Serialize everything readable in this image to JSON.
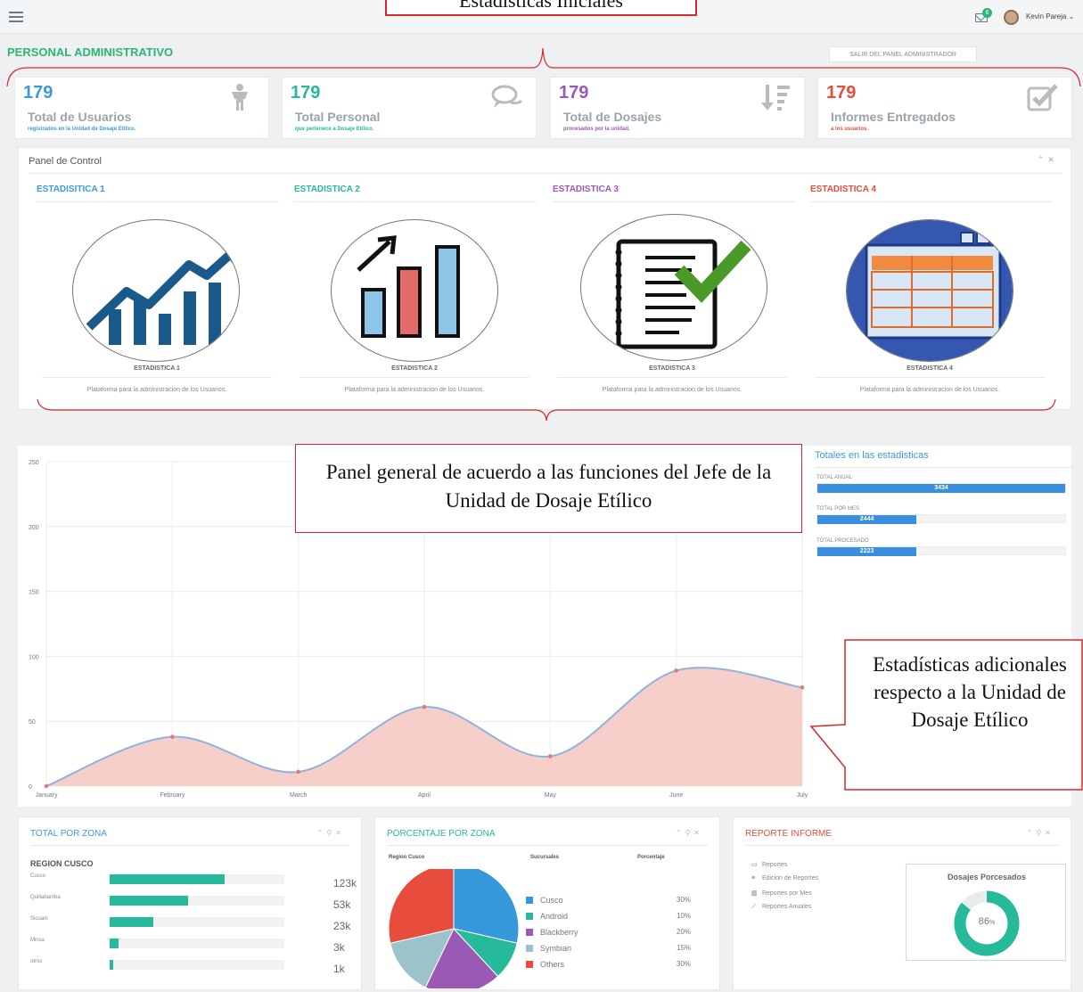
{
  "top_annotation": "Estadísticas Iniciales",
  "header": {
    "user_name": "Kevin Pareja",
    "mail_badge": "6"
  },
  "page_title": "PERSONAL ADMINISTRATIVO",
  "exit_button": "SALIR DEL PANEL ADMINISTRADOR",
  "stats": [
    {
      "value": "179",
      "label": "Total de Usuarios",
      "sub": "registrados en la Unidad de Dosaje Etílico.",
      "color": "#3b9ad9",
      "icon": "person-icon"
    },
    {
      "value": "179",
      "label": "Total Personal",
      "sub": "que pertenece a Dosaje Etílico.",
      "color": "#26b99a",
      "icon": "chat-icon"
    },
    {
      "value": "179",
      "label": "Total de Dosajes",
      "sub": "procesados por la unidad.",
      "color": "#9b59b6",
      "icon": "sort-icon"
    },
    {
      "value": "179",
      "label": "Informes Entregados",
      "sub": "a los usuarios.",
      "color": "#e74c3c",
      "icon": "checkbox-icon"
    }
  ],
  "control_panel": {
    "title": "Panel de Control",
    "columns": [
      {
        "title": "ESTADISITICA 1",
        "caption": "ESTADISTICA 1",
        "desc": "Plataforma para la administracion de los Usuarios.",
        "color": "#3b9ad9"
      },
      {
        "title": "ESTADISTICA 2",
        "caption": "ESTADISTICA 2",
        "desc": "Plataforma para la administracion de los Usuarios.",
        "color": "#26b99a"
      },
      {
        "title": "ESTADISTICA 3",
        "caption": "ESTADISTICA 3",
        "desc": "Plataforma para la administracion de los Usuarios.",
        "color": "#9b59b6"
      },
      {
        "title": "ESTADISTICA 4",
        "caption": "ESTADISTICA 4",
        "desc": "Plataforma para la administracion de los Usuarios.",
        "color": "#e74c3c"
      }
    ]
  },
  "callouts": {
    "panel_general": "Panel general de acuerdo a las funciones del Jefe de la Unidad de Dosaje Etílico",
    "adicionales": "Estadísticas adicionales respecto a la Unidad de Dosaje Etílico"
  },
  "chart_data": {
    "type": "area",
    "x": [
      "January",
      "February",
      "March",
      "April",
      "May",
      "June",
      "July"
    ],
    "series": [
      {
        "values": [
          0,
          38,
          11,
          61,
          23,
          89,
          76
        ]
      }
    ],
    "ylim": [
      0,
      250
    ],
    "yticks": [
      "0",
      "50",
      "100",
      "150",
      "200",
      "250"
    ],
    "grid": true,
    "fill_color": "#f6cfcb",
    "line_color": "#8fb3dd",
    "point_color": "#e07a7a"
  },
  "totals": {
    "title": "Totales en las estadisticas",
    "rows": [
      {
        "label": "TOTAL ANUAL",
        "value": "3434",
        "fraction": 1.0
      },
      {
        "label": "TOTAL POR MES",
        "value": "2444",
        "fraction": 0.4
      },
      {
        "label": "TOTAL PROCESADO",
        "value": "2223",
        "fraction": 0.4
      }
    ]
  },
  "zona": {
    "title": "TOTAL POR ZONA",
    "region": "REGION CUSCO",
    "rows": [
      {
        "name": "Cusco",
        "value": "123k",
        "fraction": 0.66
      },
      {
        "name": "Quillabamba",
        "value": "53k",
        "fraction": 0.45
      },
      {
        "name": "Sicuani",
        "value": "23k",
        "fraction": 0.25
      },
      {
        "name": "Minsa",
        "value": "3k",
        "fraction": 0.05
      },
      {
        "name": "otros",
        "value": "1k",
        "fraction": 0.02
      }
    ]
  },
  "porcentaje": {
    "title": "PORCENTAJE POR ZONA",
    "headers": [
      "Region Cusco",
      "Sucursales",
      "Porcentaje"
    ],
    "items": [
      {
        "name": "Cusco",
        "pct": "30%",
        "value": 30,
        "color": "#3498db"
      },
      {
        "name": "Android",
        "pct": "10%",
        "value": 10,
        "color": "#26b99a"
      },
      {
        "name": "Blackberry",
        "pct": "20%",
        "value": 20,
        "color": "#9b59b6"
      },
      {
        "name": "Symbian",
        "pct": "15%",
        "value": 15,
        "color": "#9cc2cb"
      },
      {
        "name": "Others",
        "pct": "30%",
        "value": 30,
        "color": "#e74c3c"
      }
    ]
  },
  "reporte": {
    "title": "REPORTE INFORME",
    "links": [
      {
        "label": "Reportes",
        "icon": "calendar-icon",
        "glyph": "▭"
      },
      {
        "label": "Edicion de Reportes",
        "icon": "list-icon",
        "glyph": "≡"
      },
      {
        "label": "Reportes por Mes",
        "icon": "bar-chart-icon",
        "glyph": "▥"
      },
      {
        "label": "Reportes Anuales",
        "icon": "line-chart-icon",
        "glyph": "⟋"
      }
    ],
    "donut_title": "Dosajes Porcesados",
    "donut_value": 86,
    "donut_label": "86",
    "donut_unit": "%"
  }
}
